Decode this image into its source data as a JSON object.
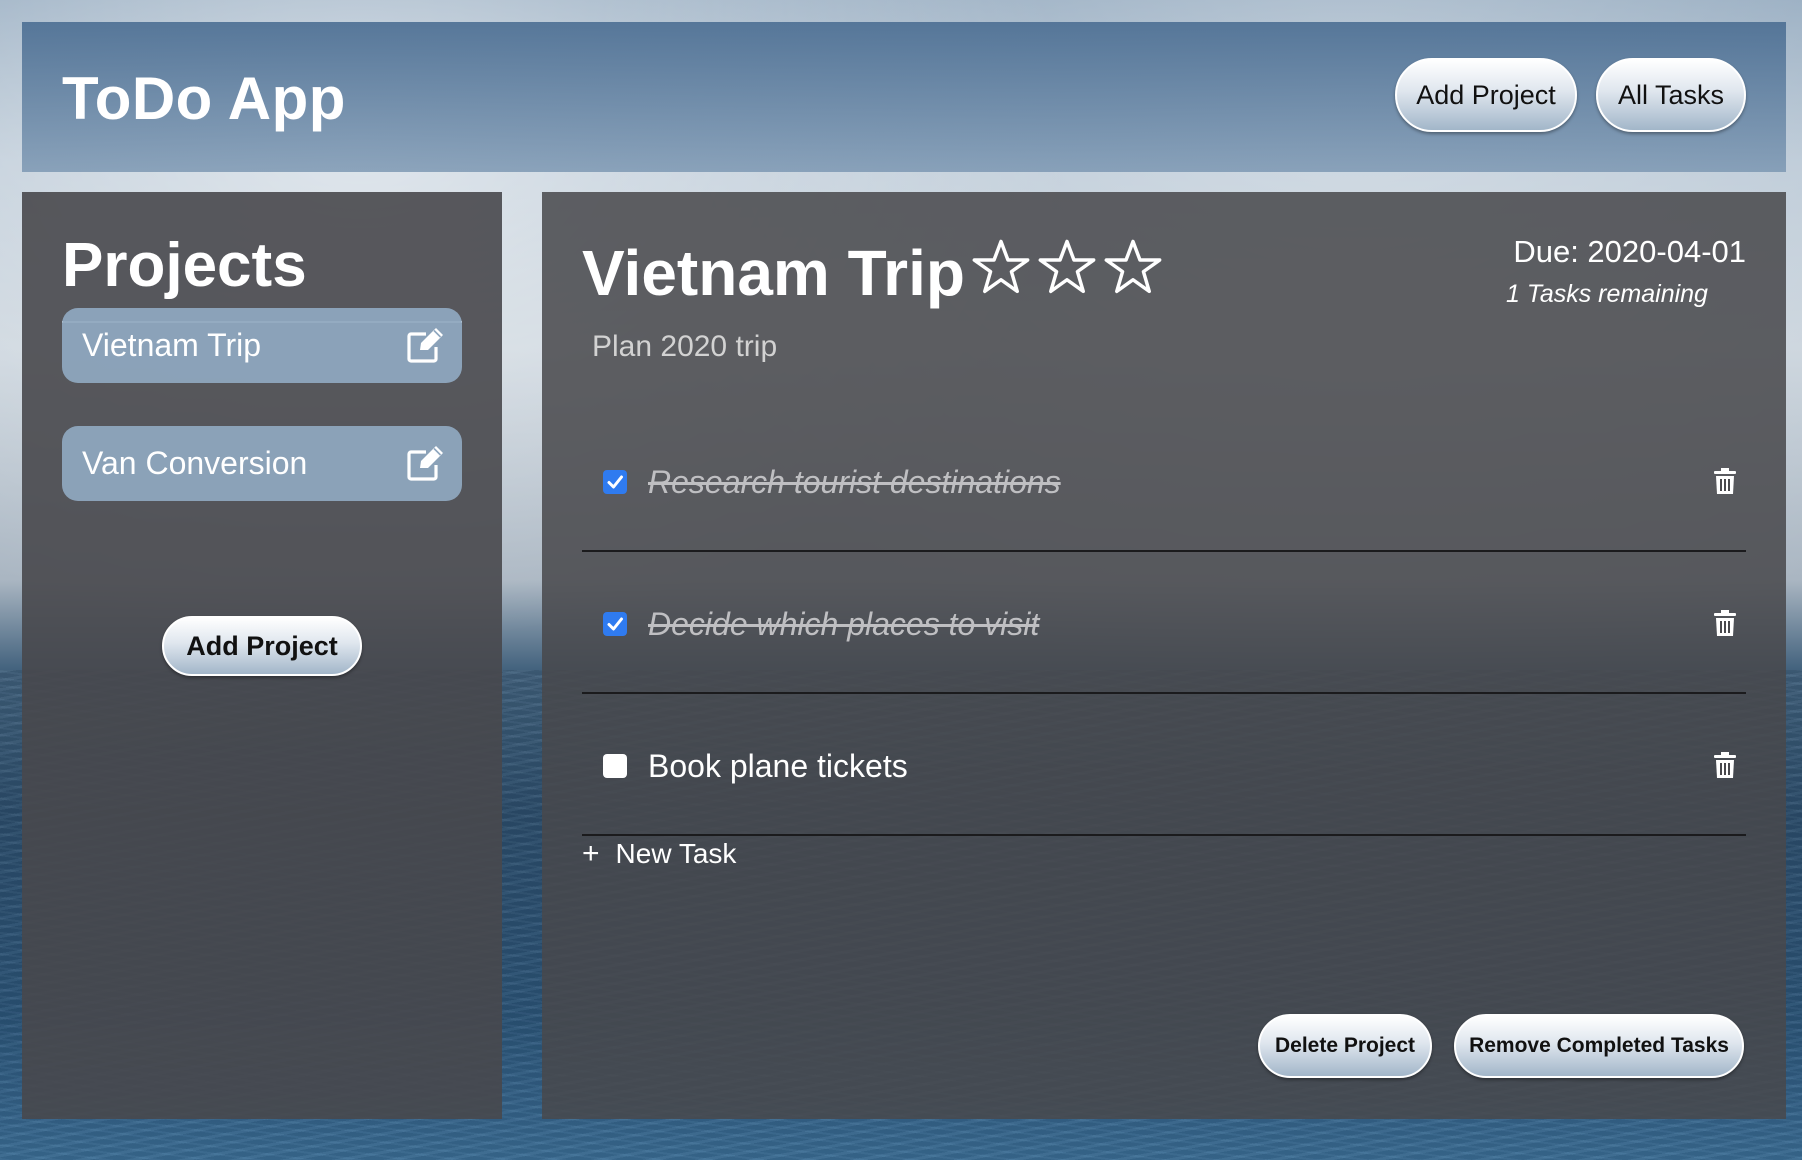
{
  "header": {
    "title": "ToDo App",
    "add_project_label": "Add Project",
    "all_tasks_label": "All Tasks"
  },
  "sidebar": {
    "title": "Projects",
    "projects": [
      {
        "label": "Vietnam Trip",
        "icon": "edit-icon"
      },
      {
        "label": "Van Conversion",
        "icon": "edit-icon"
      }
    ],
    "add_project_label": "Add Project"
  },
  "project": {
    "title": "Vietnam Trip",
    "priority_stars": 3,
    "description": "Plan 2020 trip",
    "due": "Due: 2020-04-01",
    "tasks_remaining": "1 Tasks remaining",
    "tasks": [
      {
        "text": "Research tourist destinations",
        "done": true
      },
      {
        "text": "Decide which places to visit",
        "done": true
      },
      {
        "text": "Book plane tickets",
        "done": false
      }
    ],
    "new_task_label": "New Task",
    "delete_label": "Delete Project",
    "remove_completed_label": "Remove Completed Tasks"
  },
  "colors": {
    "checkbox_accent": "#2f7bf0",
    "project_item_bg": "#8ea6be",
    "panel_bg": "#48484c"
  }
}
